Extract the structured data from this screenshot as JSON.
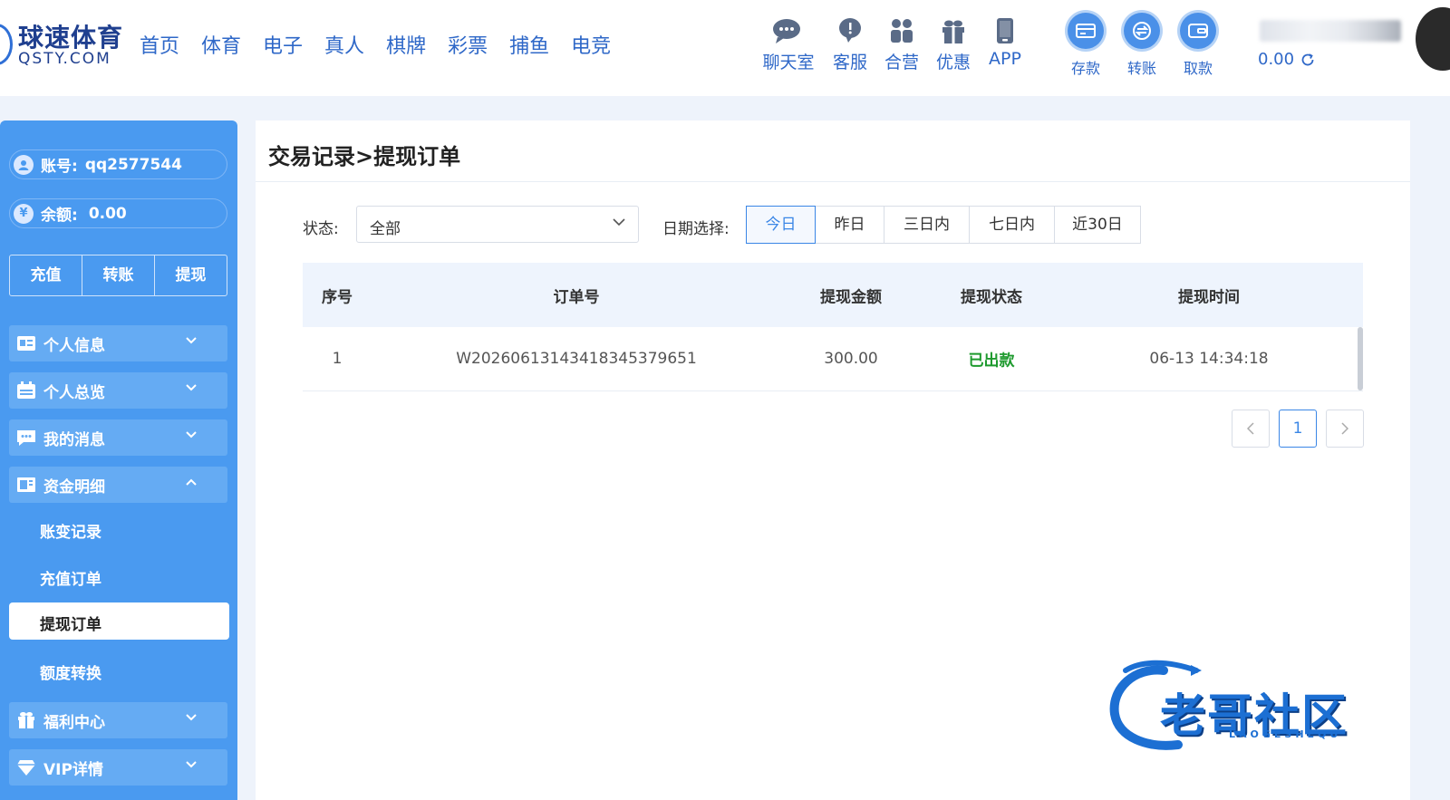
{
  "header": {
    "logo_main": "球速体育",
    "logo_sub": "QSTY.COM",
    "nav": [
      "首页",
      "体育",
      "电子",
      "真人",
      "棋牌",
      "彩票",
      "捕鱼",
      "电竞"
    ],
    "tools": {
      "chat": "聊天室",
      "service": "客服",
      "partner": "合营",
      "promo": "优惠",
      "app": "APP"
    },
    "funds": {
      "deposit": "存款",
      "transfer": "转账",
      "withdraw": "取款"
    },
    "balance": "0.00"
  },
  "sidebar": {
    "account_label": "账号:",
    "account_value": "qq2577544",
    "balance_label": "余额:",
    "balance_value": "0.00",
    "quick": {
      "recharge": "充值",
      "transfer": "转账",
      "withdraw": "提现"
    },
    "menu": {
      "personal_info": "个人信息",
      "overview": "个人总览",
      "messages": "我的消息",
      "funds": "资金明细",
      "welfare": "福利中心",
      "vip": "VIP详情"
    },
    "submenu": {
      "account_changes": "账变记录",
      "recharge_orders": "充值订单",
      "withdraw_orders": "提现订单",
      "quota_transfer": "额度转换"
    }
  },
  "main": {
    "title": "交易记录>提现订单",
    "status_label": "状态:",
    "status_value": "全部",
    "date_label": "日期选择:",
    "date_options": [
      "今日",
      "昨日",
      "三日内",
      "七日内",
      "近30日"
    ],
    "columns": {
      "seq": "序号",
      "order": "订单号",
      "amount": "提现金额",
      "status": "提现状态",
      "time": "提现时间"
    },
    "rows": [
      {
        "seq": "1",
        "order": "W202606131434183453796 51",
        "amount": "300.00",
        "status": "已出款",
        "time": "06-13 14:34:18"
      }
    ],
    "page": "1"
  },
  "watermark": {
    "text": "老哥社区",
    "sub": "LAOGESHEQU"
  },
  "colors": {
    "primary": "#2f68c8",
    "sidebar": "#4a9af0",
    "success": "#1e9a2e"
  }
}
